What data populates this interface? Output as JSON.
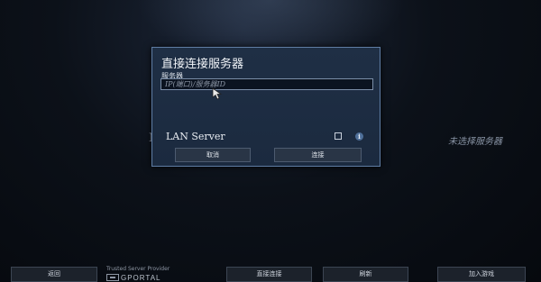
{
  "background": {
    "side_letter": "N",
    "right_status": "未选择服务器"
  },
  "dialog": {
    "title": "直接连接服务器",
    "server_label": "服务器",
    "server_input": {
      "value": "",
      "placeholder": "IP(端口)/服务器ID"
    },
    "lan_label": "LAN Server",
    "lan_checked": false,
    "info_icon": "info-icon",
    "cancel_label": "取消",
    "connect_label": "连接"
  },
  "bottom_bar": {
    "back_label": "返回",
    "sponsor_caption": "Trusted Server Provider",
    "sponsor_name": "GPORTAL",
    "direct_connect_label": "直接连接",
    "refresh_label": "刷新",
    "join_label": "加入游戏"
  },
  "colors": {
    "dialog_bg": "#1d2c42",
    "dialog_border": "#5f7da4",
    "button_bg": "#293546",
    "page_bg": "#0c1119"
  }
}
